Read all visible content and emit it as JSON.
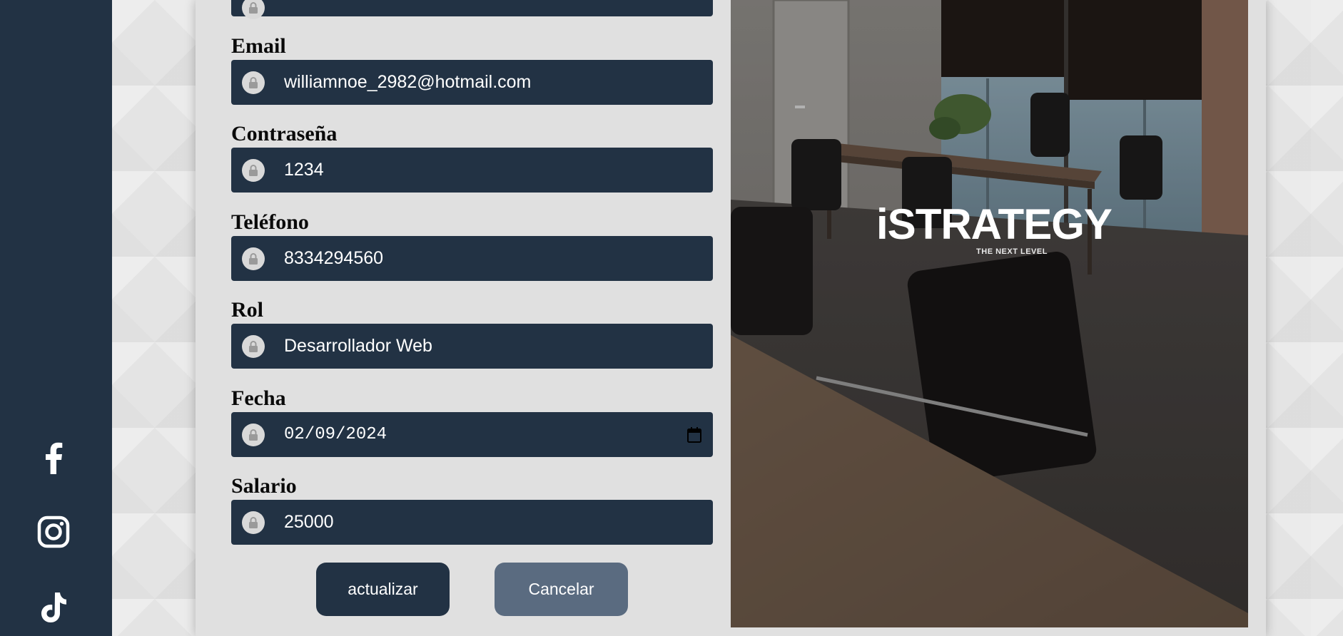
{
  "form": {
    "fields": [
      {
        "label": "Email",
        "value": "williamnoe_2982@hotmail.com",
        "icon": "lock-icon"
      },
      {
        "label": "Contraseña",
        "value": "1234",
        "icon": "lock-icon"
      },
      {
        "label": "Teléfono",
        "value": "8334294560",
        "icon": "lock-icon"
      },
      {
        "label": "Rol",
        "value": "Desarrollador Web",
        "icon": "lock-icon"
      },
      {
        "label": "Fecha",
        "value": "02/09/2024",
        "icon": "lock-icon"
      },
      {
        "label": "Salario",
        "value": "25000",
        "icon": "lock-icon"
      }
    ],
    "update_label": "actualizar",
    "cancel_label": "Cancelar"
  },
  "sidebar": {
    "social": [
      "facebook-icon",
      "instagram-icon",
      "tiktok-icon"
    ]
  },
  "brand": {
    "logo_text": "iSTRATEGY",
    "tagline": "THE NEXT LEVEL",
    "accent": "#e03a3e"
  },
  "colors": {
    "sidebar": "#223244",
    "field": "#223244",
    "update_button": "#223244",
    "cancel_button": "#5a6b80"
  }
}
